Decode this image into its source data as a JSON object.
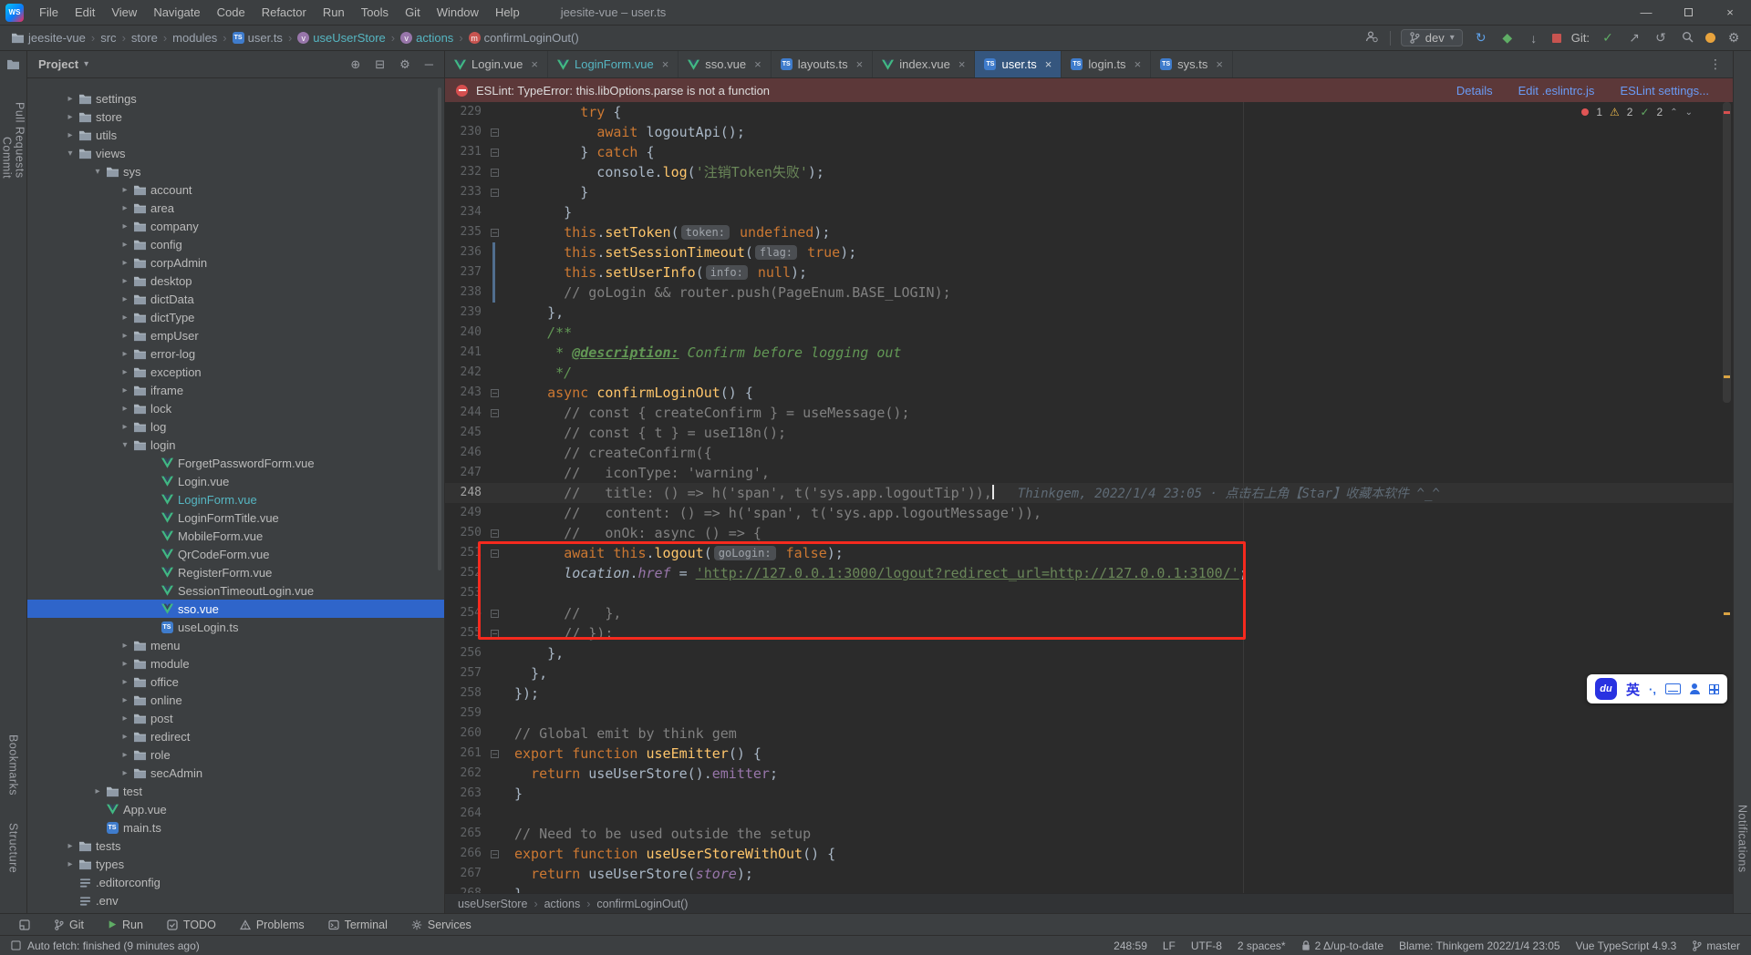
{
  "window": {
    "app_logo": "WS",
    "title": "jeesite-vue – user.ts",
    "menus": [
      "File",
      "Edit",
      "View",
      "Navigate",
      "Code",
      "Refactor",
      "Run",
      "Tools",
      "Git",
      "Window",
      "Help"
    ],
    "controls": {
      "minimize": "—",
      "close": "×"
    }
  },
  "navbar": {
    "path": [
      {
        "label": "jeesite-vue",
        "icon": "folder"
      },
      {
        "label": "src"
      },
      {
        "label": "store"
      },
      {
        "label": "modules"
      },
      {
        "label": "user.ts",
        "icon": "ts"
      },
      {
        "label": "useUserStore",
        "icon": "varr",
        "accent": true
      },
      {
        "label": "actions",
        "icon": "varr",
        "accent": true
      },
      {
        "label": "confirmLoginOut()",
        "icon": "method"
      }
    ],
    "branch": "dev",
    "git_label": "Git:"
  },
  "strips": {
    "left_top": [
      "Commit",
      "Pull Requests"
    ],
    "left_bottom": [
      "Bookmarks",
      "Structure"
    ],
    "right": [
      "Notifications"
    ]
  },
  "project": {
    "header": "Project",
    "items": [
      {
        "label": "settings",
        "lvl": 1,
        "icon": "folder",
        "chev": "r"
      },
      {
        "label": "store",
        "lvl": 1,
        "icon": "folder",
        "chev": "r"
      },
      {
        "label": "utils",
        "lvl": 1,
        "icon": "folder",
        "chev": "r"
      },
      {
        "label": "views",
        "lvl": 1,
        "icon": "folder",
        "chev": "d"
      },
      {
        "label": "sys",
        "lvl": 2,
        "icon": "folder",
        "chev": "d"
      },
      {
        "label": "account",
        "lvl": 3,
        "icon": "folder",
        "chev": "r"
      },
      {
        "label": "area",
        "lvl": 3,
        "icon": "folder",
        "chev": "r"
      },
      {
        "label": "company",
        "lvl": 3,
        "icon": "folder",
        "chev": "r"
      },
      {
        "label": "config",
        "lvl": 3,
        "icon": "folder",
        "chev": "r"
      },
      {
        "label": "corpAdmin",
        "lvl": 3,
        "icon": "folder",
        "chev": "r"
      },
      {
        "label": "desktop",
        "lvl": 3,
        "icon": "folder",
        "chev": "r"
      },
      {
        "label": "dictData",
        "lvl": 3,
        "icon": "folder",
        "chev": "r"
      },
      {
        "label": "dictType",
        "lvl": 3,
        "icon": "folder",
        "chev": "r"
      },
      {
        "label": "empUser",
        "lvl": 3,
        "icon": "folder",
        "chev": "r"
      },
      {
        "label": "error-log",
        "lvl": 3,
        "icon": "folder",
        "chev": "r"
      },
      {
        "label": "exception",
        "lvl": 3,
        "icon": "folder",
        "chev": "r"
      },
      {
        "label": "iframe",
        "lvl": 3,
        "icon": "folder",
        "chev": "r"
      },
      {
        "label": "lock",
        "lvl": 3,
        "icon": "folder",
        "chev": "r"
      },
      {
        "label": "log",
        "lvl": 3,
        "icon": "folder",
        "chev": "r"
      },
      {
        "label": "login",
        "lvl": 3,
        "icon": "folder",
        "chev": "d"
      },
      {
        "label": "ForgetPasswordForm.vue",
        "lvl": 4,
        "icon": "vue"
      },
      {
        "label": "Login.vue",
        "lvl": 4,
        "icon": "vue"
      },
      {
        "label": "LoginForm.vue",
        "lvl": 4,
        "icon": "vue",
        "color": "teal"
      },
      {
        "label": "LoginFormTitle.vue",
        "lvl": 4,
        "icon": "vue"
      },
      {
        "label": "MobileForm.vue",
        "lvl": 4,
        "icon": "vue"
      },
      {
        "label": "QrCodeForm.vue",
        "lvl": 4,
        "icon": "vue"
      },
      {
        "label": "RegisterForm.vue",
        "lvl": 4,
        "icon": "vue"
      },
      {
        "label": "SessionTimeoutLogin.vue",
        "lvl": 4,
        "icon": "vue"
      },
      {
        "label": "sso.vue",
        "lvl": 4,
        "icon": "vue",
        "sel": true
      },
      {
        "label": "useLogin.ts",
        "lvl": 4,
        "icon": "ts"
      },
      {
        "label": "menu",
        "lvl": 3,
        "icon": "folder",
        "chev": "r"
      },
      {
        "label": "module",
        "lvl": 3,
        "icon": "folder",
        "chev": "r"
      },
      {
        "label": "office",
        "lvl": 3,
        "icon": "folder",
        "chev": "r"
      },
      {
        "label": "online",
        "lvl": 3,
        "icon": "folder",
        "chev": "r"
      },
      {
        "label": "post",
        "lvl": 3,
        "icon": "folder",
        "chev": "r"
      },
      {
        "label": "redirect",
        "lvl": 3,
        "icon": "folder",
        "chev": "r"
      },
      {
        "label": "role",
        "lvl": 3,
        "icon": "folder",
        "chev": "r"
      },
      {
        "label": "secAdmin",
        "lvl": 3,
        "icon": "folder",
        "chev": "r"
      },
      {
        "label": "test",
        "lvl": 2,
        "icon": "folder",
        "chev": "r"
      },
      {
        "label": "App.vue",
        "lvl": 2,
        "icon": "vue"
      },
      {
        "label": "main.ts",
        "lvl": 2,
        "icon": "ts"
      },
      {
        "label": "tests",
        "lvl": 1,
        "icon": "folder",
        "chev": "r"
      },
      {
        "label": "types",
        "lvl": 1,
        "icon": "folder",
        "chev": "r"
      },
      {
        "label": ".editorconfig",
        "lvl": 1,
        "icon": "config"
      },
      {
        "label": ".env",
        "lvl": 1,
        "icon": "config"
      }
    ]
  },
  "tabs": [
    {
      "label": "Login.vue",
      "icon": "vue"
    },
    {
      "label": "LoginForm.vue",
      "icon": "vue",
      "color": "teal"
    },
    {
      "label": "sso.vue",
      "icon": "vue"
    },
    {
      "label": "layouts.ts",
      "icon": "ts"
    },
    {
      "label": "index.vue",
      "icon": "vue"
    },
    {
      "label": "user.ts",
      "icon": "ts",
      "active": true
    },
    {
      "label": "login.ts",
      "icon": "ts"
    },
    {
      "label": "sys.ts",
      "icon": "ts"
    }
  ],
  "banner": {
    "message": "ESLint: TypeError: this.libOptions.parse is not a function",
    "links": [
      "Details",
      "Edit .eslintrc.js",
      "ESLint settings..."
    ]
  },
  "editor": {
    "inspections": {
      "errors": "1",
      "warnings": "2",
      "ok": "2"
    },
    "blame": "Thinkgem, 2022/1/4 23:05 · 点击右上角【Star】收藏本软件 ^_^",
    "lines": [
      {
        "n": 229,
        "s": [
          [
            "d",
            "        "
          ],
          [
            "k",
            "try"
          ],
          [
            "d",
            " {"
          ]
        ]
      },
      {
        "n": 230,
        "fold": true,
        "s": [
          [
            "d",
            "          "
          ],
          [
            "k",
            "await"
          ],
          [
            "d",
            " logoutApi();"
          ]
        ]
      },
      {
        "n": 231,
        "fold": true,
        "s": [
          [
            "d",
            "        } "
          ],
          [
            "k",
            "catch"
          ],
          [
            "d",
            " {"
          ]
        ]
      },
      {
        "n": 232,
        "fold": true,
        "s": [
          [
            "d",
            "          console."
          ],
          [
            "m",
            "log"
          ],
          [
            "d",
            "("
          ],
          [
            "s",
            "'注销Token失败'"
          ],
          [
            "d",
            ");"
          ]
        ]
      },
      {
        "n": 233,
        "fold": true,
        "s": [
          [
            "d",
            "        }"
          ]
        ]
      },
      {
        "n": 234,
        "s": [
          [
            "d",
            "      }"
          ]
        ]
      },
      {
        "n": 235,
        "fold": true,
        "s": [
          [
            "d",
            "      "
          ],
          [
            "k",
            "this"
          ],
          [
            "d",
            "."
          ],
          [
            "m",
            "setToken"
          ],
          [
            "d",
            "("
          ],
          [
            "h",
            "token:"
          ],
          [
            "d",
            " "
          ],
          [
            "k",
            "undefined"
          ],
          [
            "d",
            ");"
          ]
        ]
      },
      {
        "n": 236,
        "s": [
          [
            "d",
            "      "
          ],
          [
            "k",
            "this"
          ],
          [
            "d",
            "."
          ],
          [
            "m",
            "setSessionTimeout"
          ],
          [
            "d",
            "("
          ],
          [
            "h",
            "flag:"
          ],
          [
            "d",
            " "
          ],
          [
            "k",
            "true"
          ],
          [
            "d",
            ");"
          ]
        ]
      },
      {
        "n": 237,
        "s": [
          [
            "d",
            "      "
          ],
          [
            "k",
            "this"
          ],
          [
            "d",
            "."
          ],
          [
            "m",
            "setUserInfo"
          ],
          [
            "d",
            "("
          ],
          [
            "h",
            "info:"
          ],
          [
            "d",
            " "
          ],
          [
            "k",
            "null"
          ],
          [
            "d",
            ");"
          ]
        ]
      },
      {
        "n": 238,
        "s": [
          [
            "d",
            "      "
          ],
          [
            "c",
            "// goLogin && router.push(PageEnum.BASE_LOGIN);"
          ]
        ]
      },
      {
        "n": 239,
        "s": [
          [
            "d",
            "    },"
          ]
        ]
      },
      {
        "n": 240,
        "s": [
          [
            "dc",
            "    /**"
          ]
        ]
      },
      {
        "n": 241,
        "s": [
          [
            "dc",
            "     * "
          ],
          [
            "dt",
            "@description:"
          ],
          [
            "dc",
            " Confirm before logging out"
          ]
        ]
      },
      {
        "n": 242,
        "s": [
          [
            "dc",
            "     */"
          ]
        ]
      },
      {
        "n": 243,
        "fold": true,
        "s": [
          [
            "d",
            "    "
          ],
          [
            "k",
            "async"
          ],
          [
            "d",
            " "
          ],
          [
            "m",
            "confirmLoginOut"
          ],
          [
            "d",
            "() {"
          ]
        ]
      },
      {
        "n": 244,
        "fold": true,
        "s": [
          [
            "d",
            "      "
          ],
          [
            "c",
            "// const { createConfirm } = useMessage();"
          ]
        ]
      },
      {
        "n": 245,
        "s": [
          [
            "d",
            "      "
          ],
          [
            "c",
            "// const { t } = useI18n();"
          ]
        ]
      },
      {
        "n": 246,
        "s": [
          [
            "d",
            "      "
          ],
          [
            "c",
            "// createConfirm({"
          ]
        ]
      },
      {
        "n": 247,
        "s": [
          [
            "d",
            "      "
          ],
          [
            "c",
            "//   iconType: 'warning',"
          ]
        ]
      },
      {
        "n": 248,
        "cur": true,
        "caret": true,
        "blame": true,
        "s": [
          [
            "d",
            "      "
          ],
          [
            "c",
            "//   title: () => h('span', t('sys.app.logoutTip')),"
          ]
        ]
      },
      {
        "n": 249,
        "s": [
          [
            "d",
            "      "
          ],
          [
            "c",
            "//   content: () => h('span', t('sys.app.logoutMessage')),"
          ]
        ]
      },
      {
        "n": 250,
        "fold": true,
        "s": [
          [
            "d",
            "      "
          ],
          [
            "c",
            "//   onOk: async () => {"
          ]
        ]
      },
      {
        "n": 251,
        "fold": true,
        "s": [
          [
            "d",
            "      "
          ],
          [
            "k",
            "await"
          ],
          [
            "d",
            " "
          ],
          [
            "k",
            "this"
          ],
          [
            "d",
            "."
          ],
          [
            "m",
            "logout"
          ],
          [
            "d",
            "("
          ],
          [
            "h",
            "goLogin:"
          ],
          [
            "d",
            " "
          ],
          [
            "k",
            "false"
          ],
          [
            "d",
            ");"
          ]
        ]
      },
      {
        "n": 252,
        "s": [
          [
            "d",
            "      "
          ],
          [
            "g",
            "location"
          ],
          [
            "d",
            "."
          ],
          [
            "fi",
            "href"
          ],
          [
            "d",
            " = "
          ],
          [
            "u",
            "'http://127.0.0.1:3000/logout?redirect_url=http://127.0.0.1:3100/'"
          ],
          [
            "d",
            ";"
          ]
        ]
      },
      {
        "n": 253,
        "s": []
      },
      {
        "n": 254,
        "fold": true,
        "s": [
          [
            "d",
            "      "
          ],
          [
            "c",
            "//   },"
          ]
        ]
      },
      {
        "n": 255,
        "fold": true,
        "s": [
          [
            "d",
            "      "
          ],
          [
            "c",
            "// });"
          ]
        ]
      },
      {
        "n": 256,
        "s": [
          [
            "d",
            "    },"
          ]
        ]
      },
      {
        "n": 257,
        "s": [
          [
            "d",
            "  },"
          ]
        ]
      },
      {
        "n": 258,
        "s": [
          [
            "d",
            "});"
          ]
        ]
      },
      {
        "n": 259,
        "s": []
      },
      {
        "n": 260,
        "s": [
          [
            "c",
            "// Global emit by think gem"
          ]
        ]
      },
      {
        "n": 261,
        "fold": true,
        "s": [
          [
            "k",
            "export"
          ],
          [
            "d",
            " "
          ],
          [
            "k",
            "function"
          ],
          [
            "d",
            " "
          ],
          [
            "m",
            "useEmitter"
          ],
          [
            "d",
            "() {"
          ]
        ]
      },
      {
        "n": 262,
        "s": [
          [
            "d",
            "  "
          ],
          [
            "k",
            "return"
          ],
          [
            "d",
            " useUserStore()."
          ],
          [
            "f",
            "emitter"
          ],
          [
            "d",
            ";"
          ]
        ]
      },
      {
        "n": 263,
        "s": [
          [
            "d",
            "}"
          ]
        ]
      },
      {
        "n": 264,
        "s": []
      },
      {
        "n": 265,
        "s": [
          [
            "c",
            "// Need to be used outside the setup"
          ]
        ]
      },
      {
        "n": 266,
        "fold": true,
        "s": [
          [
            "k",
            "export"
          ],
          [
            "d",
            " "
          ],
          [
            "k",
            "function"
          ],
          [
            "d",
            " "
          ],
          [
            "m",
            "useUserStoreWithOut"
          ],
          [
            "d",
            "() {"
          ]
        ]
      },
      {
        "n": 267,
        "s": [
          [
            "d",
            "  "
          ],
          [
            "k",
            "return"
          ],
          [
            "d",
            " useUserStore("
          ],
          [
            "fi",
            "store"
          ],
          [
            "d",
            ");"
          ]
        ]
      },
      {
        "n": 268,
        "s": [
          [
            "d",
            "}"
          ]
        ]
      }
    ]
  },
  "crumbs": [
    "useUserStore",
    "actions",
    "confirmLoginOut()"
  ],
  "toolbar": [
    {
      "label": "Git",
      "icon": "branch"
    },
    {
      "label": "Run",
      "icon": "play"
    },
    {
      "label": "TODO",
      "icon": "todo"
    },
    {
      "label": "Problems",
      "icon": "problems"
    },
    {
      "label": "Terminal",
      "icon": "terminal"
    },
    {
      "label": "Services",
      "icon": "services"
    }
  ],
  "status": {
    "left": "Auto fetch: finished (9 minutes ago)",
    "right": [
      {
        "label": "248:59"
      },
      {
        "label": "LF"
      },
      {
        "label": "UTF-8"
      },
      {
        "label": "2 spaces*"
      },
      {
        "label": "2 Δ/up-to-date",
        "icon": "lock"
      },
      {
        "label": "Blame: Thinkgem 2022/1/4 23:05"
      },
      {
        "label": "Vue TypeScript 4.9.3"
      },
      {
        "label": "master",
        "icon": "branch"
      }
    ]
  },
  "ime": {
    "logo": "du",
    "lang": "英"
  }
}
